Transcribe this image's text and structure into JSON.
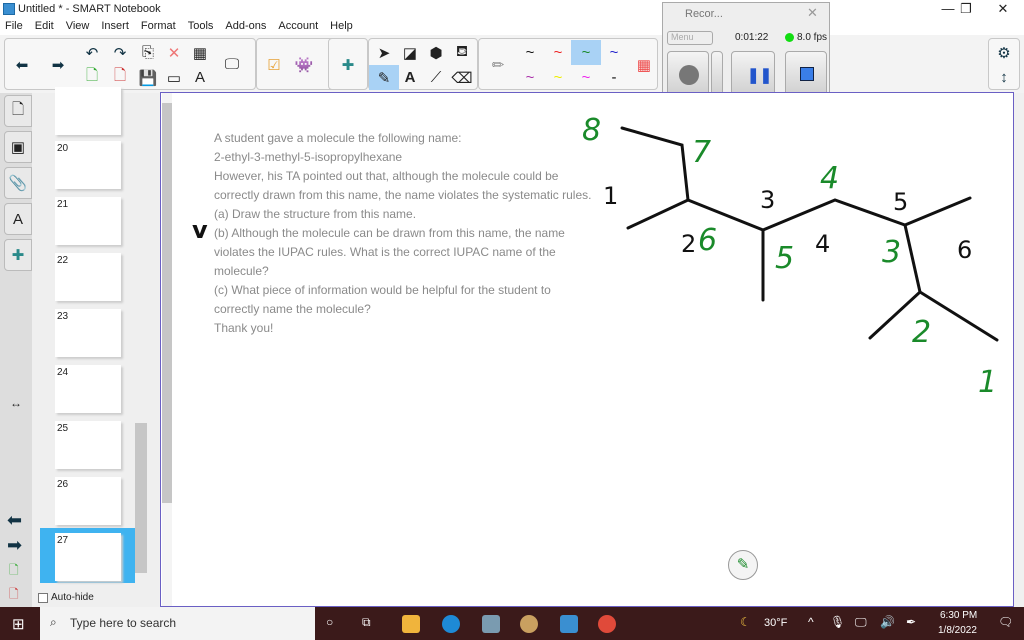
{
  "window": {
    "title": "Untitled * - SMART Notebook",
    "minimize": "—",
    "maximize": "❐",
    "close": "✕"
  },
  "menu": [
    "File",
    "Edit",
    "View",
    "Insert",
    "Format",
    "Tools",
    "Add-ons",
    "Account",
    "Help"
  ],
  "recorder": {
    "title": "Recor...",
    "menu": "Menu",
    "time": "0:01:22",
    "fps": "8.0 fps"
  },
  "sidebar": {
    "pages": [
      "20",
      "21",
      "22",
      "23",
      "24",
      "25",
      "26",
      "27"
    ],
    "autohide": "Auto-hide"
  },
  "question": {
    "lines": [
      "A student gave a molecule the following name:",
      "2-ethyl-3-methyl-5-isopropylhexane",
      "However, his TA pointed out that, although the molecule could be correctly drawn from this name, the name violates the systematic rules.",
      "(a) Draw the structure from this name.",
      "(b) Although the molecule can be drawn from this name, the name violates the IUPAC rules. What is the correct IUPAC name of the molecule?",
      "(c) What piece of information would be helpful for the student to correctly name the molecule?",
      "Thank you!"
    ]
  },
  "annotations": {
    "green": [
      "8",
      "7",
      "4",
      "6",
      "5",
      "3",
      "2",
      "1"
    ],
    "black": [
      "1",
      "3",
      "5",
      "4",
      "6",
      "2",
      "v"
    ]
  },
  "colors": {
    "ink_green": "#1a8a2a",
    "ink_black": "#111111",
    "accent": "#3fb3f0"
  },
  "taskbar": {
    "search_placeholder": "Type here to search",
    "weather": "30°F",
    "time": "6:30 PM",
    "date": "1/8/2022"
  }
}
